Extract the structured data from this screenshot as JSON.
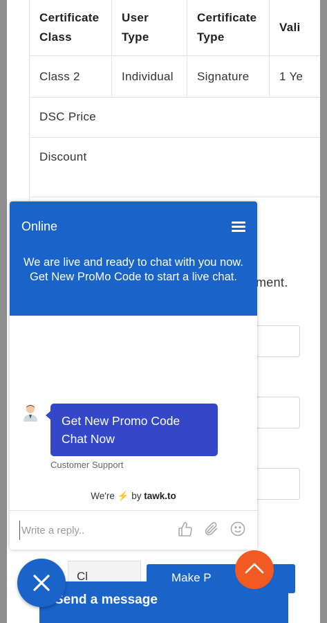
{
  "table": {
    "headers": [
      "Certificate Class",
      "User Type",
      "Certificate Type",
      "Validity"
    ],
    "header_lines": [
      [
        "Certificate",
        "Class"
      ],
      [
        "User",
        "Type"
      ],
      [
        "Certificate",
        "Type"
      ],
      [
        "Vali"
      ]
    ],
    "row": [
      "Class 2",
      "Individual",
      "Signature",
      "1 Ye"
    ],
    "price_label": "DSC Price",
    "discount_label": "Discount"
  },
  "page_text": "ment.",
  "chat": {
    "status": "Online",
    "intro": "We are live and ready to chat with you now. Get New ProMo Code to start a live chat.",
    "message": "Get New Promo Code Chat Now",
    "agent_name": "Customer Support",
    "powered_prefix": "We're",
    "powered_by": "by",
    "powered_brand": "tawk.to",
    "reply_placeholder": "Write a reply.."
  },
  "buttons": {
    "left_partial": "Cl",
    "right_partial": "Make P",
    "send_message": "Send a message"
  },
  "colors": {
    "chat_blue": "#1a63c9",
    "bubble_blue": "#3447c9",
    "scroll_top_orange": "#f15a22"
  },
  "icons": {
    "menu": "hamburger-icon",
    "like": "thumbs-up-icon",
    "attach": "paperclip-icon",
    "emoji": "smiley-icon",
    "close": "close-icon",
    "scroll": "chevron-up-icon"
  }
}
